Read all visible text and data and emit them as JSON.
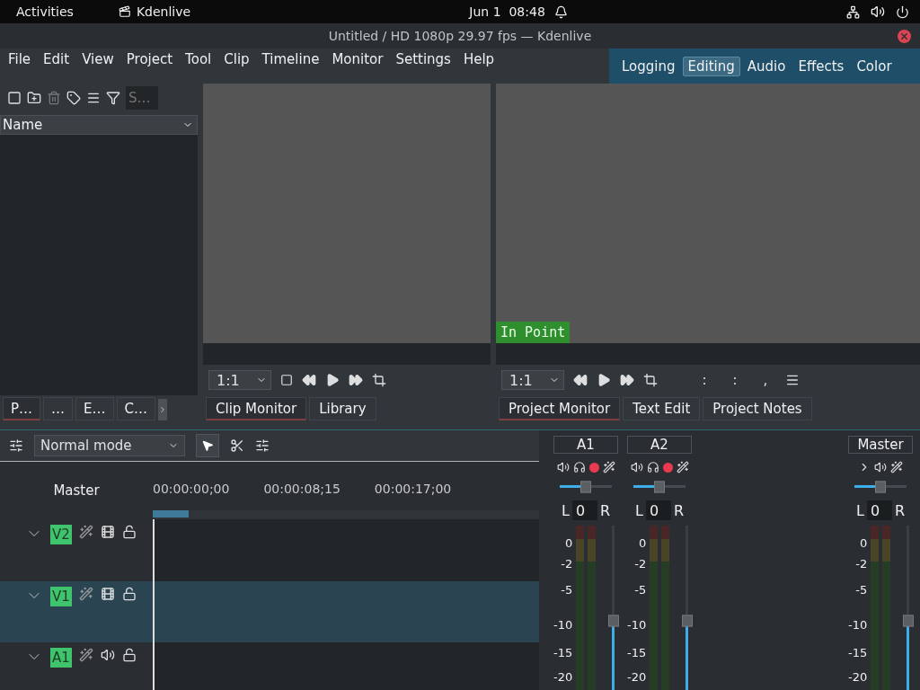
{
  "top_bar": {
    "activities": "Activities",
    "app": "Kdenlive",
    "clock": "Jun 1  08:48"
  },
  "window": {
    "title": "Untitled / HD 1080p 29.97 fps — Kdenlive"
  },
  "menu": [
    "File",
    "Edit",
    "View",
    "Project",
    "Tool",
    "Clip",
    "Timeline",
    "Monitor",
    "Settings",
    "Help"
  ],
  "layouts": [
    {
      "label": "Logging",
      "selected": false
    },
    {
      "label": "Editing",
      "selected": true
    },
    {
      "label": "Audio",
      "selected": false
    },
    {
      "label": "Effects",
      "selected": false
    },
    {
      "label": "Color",
      "selected": false
    }
  ],
  "bin": {
    "search_placeholder": "S…",
    "column": "Name",
    "tabs": [
      {
        "label": "P…",
        "selected": true
      },
      {
        "label": "…",
        "selected": false
      },
      {
        "label": "E…",
        "selected": false
      },
      {
        "label": "C…",
        "selected": false
      }
    ]
  },
  "clip_monitor": {
    "zoom": "1:1",
    "tabs": [
      {
        "label": "Clip Monitor",
        "selected": true
      },
      {
        "label": "Library",
        "selected": false
      }
    ]
  },
  "project_monitor": {
    "zoom": "1:1",
    "marker": "In Point",
    "timecode": [
      ":",
      ":",
      ","
    ],
    "tabs": [
      {
        "label": "Project Monitor",
        "selected": true
      },
      {
        "label": "Text Edit",
        "selected": false
      },
      {
        "label": "Project Notes",
        "selected": false
      }
    ]
  },
  "timeline": {
    "mode": "Normal mode",
    "master": "Master",
    "ruler": [
      "00:00:00;00",
      "00:00:08;15",
      "00:00:17;00"
    ],
    "tracks": [
      {
        "name": "V2",
        "kind": "video",
        "selected": false
      },
      {
        "name": "V1",
        "kind": "video",
        "selected": true
      },
      {
        "name": "A1",
        "kind": "audio",
        "selected": false
      }
    ]
  },
  "mixer": {
    "channels": [
      {
        "name": "A1",
        "kind": "track",
        "volume": {
          "level": 0.5
        },
        "pan_left": "L",
        "pan_right": "R",
        "pan": "0",
        "fader": {
          "level": 0.42
        },
        "scale": [
          "0",
          "-2",
          "-5",
          "-10",
          "-15",
          "-20"
        ]
      },
      {
        "name": "A2",
        "kind": "track",
        "volume": {
          "level": 0.5
        },
        "pan_left": "L",
        "pan_right": "R",
        "pan": "0",
        "fader": {
          "level": 0.42
        },
        "scale": [
          "0",
          "-2",
          "-5",
          "-10",
          "-15",
          "-20"
        ]
      },
      {
        "name": "Master",
        "kind": "master",
        "volume": {
          "level": 0.5
        },
        "pan_left": "L",
        "pan_right": "R",
        "pan": "0",
        "fader": {
          "level": 0.42
        },
        "scale": [
          "0",
          "-2",
          "-5",
          "-10",
          "-15",
          "-20"
        ]
      }
    ]
  }
}
